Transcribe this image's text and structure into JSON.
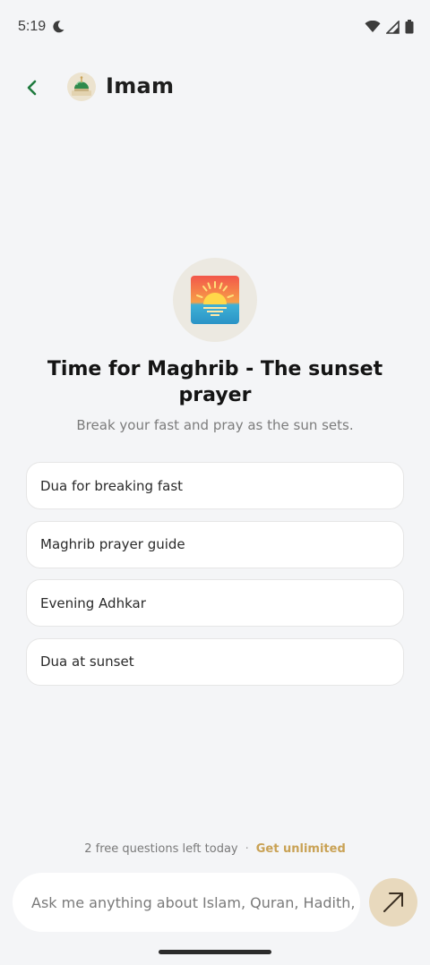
{
  "status_bar": {
    "time": "5:19"
  },
  "header": {
    "title": "Imam"
  },
  "hero": {
    "icon": "sunset-icon",
    "headline": "Time for Maghrib - The sunset prayer",
    "subtitle": "Break your fast and pray as the sun sets."
  },
  "suggestions": [
    {
      "label": "Dua for breaking fast"
    },
    {
      "label": "Maghrib prayer guide"
    },
    {
      "label": "Evening Adhkar"
    },
    {
      "label": "Dua at sunset"
    }
  ],
  "quota": {
    "text": "2 free questions left today",
    "separator": "·",
    "cta": "Get unlimited"
  },
  "composer": {
    "placeholder": "Ask me anything about Islam, Quran, Hadith, and more"
  },
  "colors": {
    "accent_gold": "#c9a255",
    "back_green": "#1f7a3e",
    "send_bg": "#e8d9bd"
  }
}
